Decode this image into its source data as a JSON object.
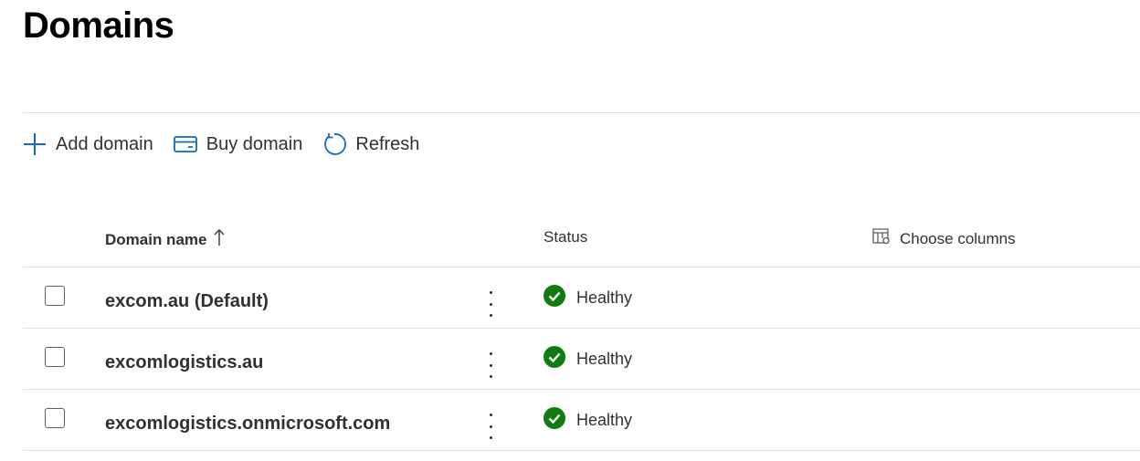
{
  "page": {
    "title": "Domains"
  },
  "toolbar": {
    "add_label": "Add domain",
    "buy_label": "Buy domain",
    "refresh_label": "Refresh",
    "icon_color": "#0f6cbd"
  },
  "table": {
    "columns": {
      "name": "Domain name",
      "status": "Status",
      "choose_columns": "Choose columns"
    },
    "sort": "ascending",
    "rows": [
      {
        "domain": "excom.au (Default)",
        "status": "Healthy"
      },
      {
        "domain": "excomlogistics.au",
        "status": "Healthy"
      },
      {
        "domain": "excomlogistics.onmicrosoft.com",
        "status": "Healthy"
      }
    ]
  },
  "colors": {
    "healthy": "#107c10",
    "divider": "#e1dfdd"
  },
  "icons": {
    "add": "plus-icon",
    "buy": "card-icon",
    "refresh": "refresh-icon",
    "sort": "arrow-up-icon",
    "columns": "columns-icon",
    "status": "check-circle-icon",
    "more": "more-vertical-icon"
  }
}
